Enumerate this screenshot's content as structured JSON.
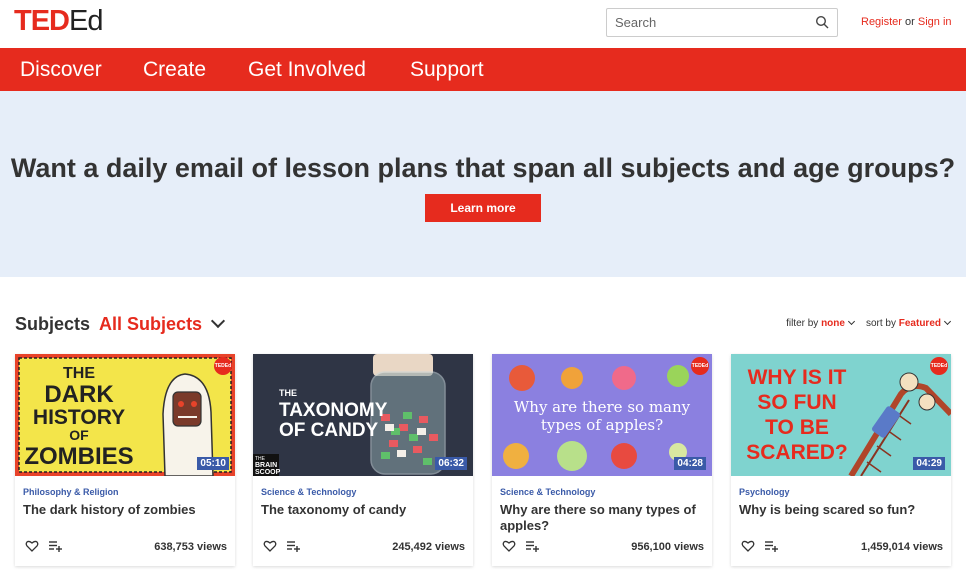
{
  "header": {
    "logo_ted": "TED",
    "logo_ed": "Ed",
    "search_placeholder": "Search",
    "register": "Register",
    "or": "or",
    "sign_in": "Sign in"
  },
  "nav": [
    "Discover",
    "Create",
    "Get Involved",
    "Support"
  ],
  "banner": {
    "heading": "Want a daily email of lesson plans that span all subjects and age groups?",
    "cta": "Learn more"
  },
  "subjects": {
    "label": "Subjects",
    "selected": "All Subjects"
  },
  "filters": {
    "filter_label": "filter by",
    "filter_value": "none",
    "sort_label": "sort by",
    "sort_value": "Featured"
  },
  "cards": [
    {
      "category": "Philosophy & Religion",
      "title": "The dark history of zombies",
      "views": "638,753 views",
      "duration": "05:10",
      "thumb_text": [
        "THE",
        "DARK",
        "HISTORY",
        "OF",
        "ZOMBIES"
      ]
    },
    {
      "category": "Science & Technology",
      "title": "The taxonomy of candy",
      "views": "245,492 views",
      "duration": "06:32",
      "thumb_text": [
        "THE",
        "TAXONOMY",
        "OF CANDY"
      ],
      "thumb_brand": [
        "BRAIN",
        "SCOOP"
      ],
      "thumb_brand_small": "THE"
    },
    {
      "category": "Science & Technology",
      "title": "Why are there so many types of apples?",
      "views": "956,100 views",
      "duration": "04:28",
      "thumb_text": [
        "Why are there so many",
        "types of apples?"
      ]
    },
    {
      "category": "Psychology",
      "title": "Why is being scared so fun?",
      "views": "1,459,014 views",
      "duration": "04:29",
      "thumb_text": [
        "WHY IS IT",
        "SO FUN",
        "TO BE",
        "SCARED?"
      ]
    }
  ],
  "badge_text": "TEDEd",
  "colors": {
    "brand_red": "#e62b1e",
    "banner_bg": "#e6eef9",
    "category_blue": "#3a5aa8"
  }
}
